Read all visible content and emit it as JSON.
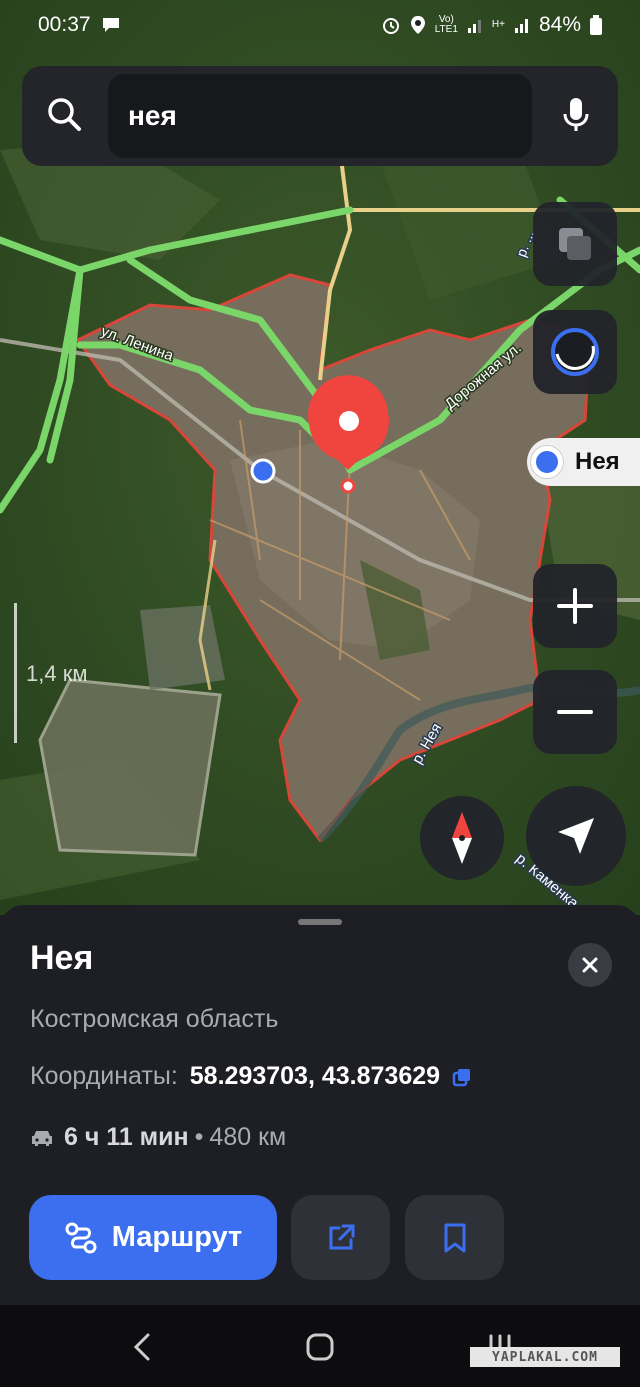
{
  "status_bar": {
    "time": "00:37",
    "network_label": "LTE1",
    "signal_label": "H+",
    "battery": "84%"
  },
  "search": {
    "query": "нея"
  },
  "map": {
    "place_chip_label": "Нея",
    "street_labels": [
      "ул. Ленина",
      "Дорожная ул.",
      "р. Нея",
      "р. Каменка",
      "р. ..."
    ],
    "scale_label": "1,4 км"
  },
  "place_card": {
    "title": "Нея",
    "region": "Костромская область",
    "coords_label": "Координаты:",
    "coords_value": "58.293703, 43.873629",
    "drive_time": "6 ч 11 мин",
    "drive_separator": "•",
    "drive_distance": "480 км",
    "route_button_label": "Маршрут"
  },
  "watermark": "YAPLAKAL.COM",
  "colors": {
    "accent": "#3b6ff0",
    "pin": "#f0453e",
    "road": "#7bd66a",
    "boundary": "#e0463a"
  }
}
